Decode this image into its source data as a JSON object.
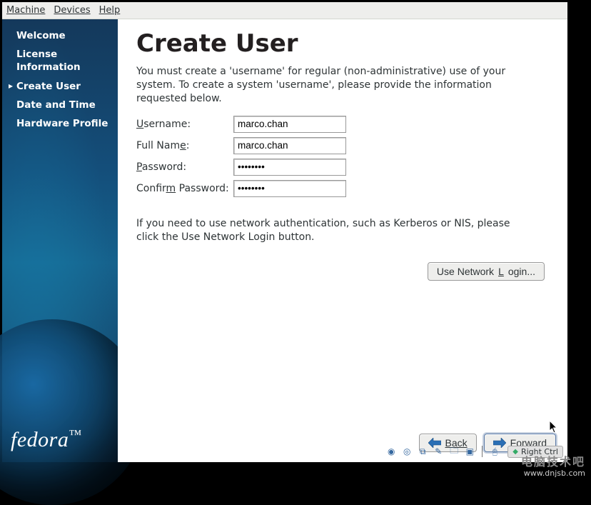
{
  "menubar": {
    "machine": "Machine",
    "devices": "Devices",
    "help": "Help"
  },
  "sidebar": {
    "items": [
      {
        "label": "Welcome"
      },
      {
        "label": "License Information"
      },
      {
        "label": "Create User"
      },
      {
        "label": "Date and Time"
      },
      {
        "label": "Hardware Profile"
      }
    ],
    "logo": "fedora"
  },
  "main": {
    "title": "Create User",
    "intro": "You must create a 'username' for regular (non-administrative) use of your system.  To create a system 'username', please provide the information requested below.",
    "form": {
      "username_label_pre": "U",
      "username_label_post": "sername:",
      "fullname_label_pre": "Full Nam",
      "fullname_label_mid": "e",
      "fullname_label_post": ":",
      "password_label_pre": "P",
      "password_label_post": "assword:",
      "confirm_label_pre": "Confir",
      "confirm_label_mid": "m",
      "confirm_label_post": " Password:",
      "username_value": "marco.chan",
      "fullname_value": "marco.chan",
      "password_value": "••••••••",
      "confirm_value": "••••••••"
    },
    "hint": "If you need to use network authentication, such as Kerberos or NIS, please click the Use Network Login button.",
    "network_login_btn_pre": "Use Network ",
    "network_login_btn_mid": "L",
    "network_login_btn_post": "ogin...",
    "back_btn": "Back",
    "forward_btn": "Forward"
  },
  "statusbar": {
    "right_ctrl": "Right Ctrl"
  },
  "watermark": {
    "line1": "电脑技术吧",
    "line2": "www.dnjsb.com"
  }
}
